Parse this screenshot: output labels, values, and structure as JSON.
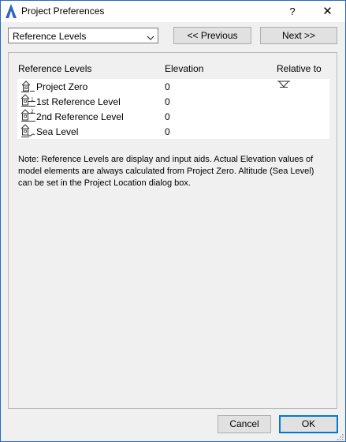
{
  "window": {
    "title": "Project Preferences",
    "help_label": "?",
    "close_label": "✕"
  },
  "toolbar": {
    "section_select": {
      "value": "Reference Levels"
    },
    "previous_label": "<< Previous",
    "next_label": "Next >>"
  },
  "table": {
    "headers": {
      "name": "Reference Levels",
      "elevation": "Elevation",
      "relative": "Relative to"
    },
    "rows": [
      {
        "name": "Project Zero",
        "elevation": "0",
        "icon": "project-zero-icon",
        "relative_marker": true
      },
      {
        "name": "1st Reference Level",
        "elevation": "0",
        "icon": "reference-level-1-icon",
        "relative_marker": false
      },
      {
        "name": "2nd Reference Level",
        "elevation": "0",
        "icon": "reference-level-2-icon",
        "relative_marker": false
      },
      {
        "name": "Sea Level",
        "elevation": "0",
        "icon": "sea-level-icon",
        "relative_marker": false
      }
    ]
  },
  "note": "Note: Reference Levels are display and input aids. Actual Elevation values of model elements are always calculated from Project Zero. Altitude (Sea Level) can be set in the Project Location dialog box.",
  "footer": {
    "cancel_label": "Cancel",
    "ok_label": "OK"
  },
  "colors": {
    "window_border": "#2b6bbd",
    "dialog_bg": "#f0f0f0",
    "button_bg": "#e1e1e1",
    "default_button_border": "#0078d7",
    "app_icon": "#2a64c4"
  }
}
